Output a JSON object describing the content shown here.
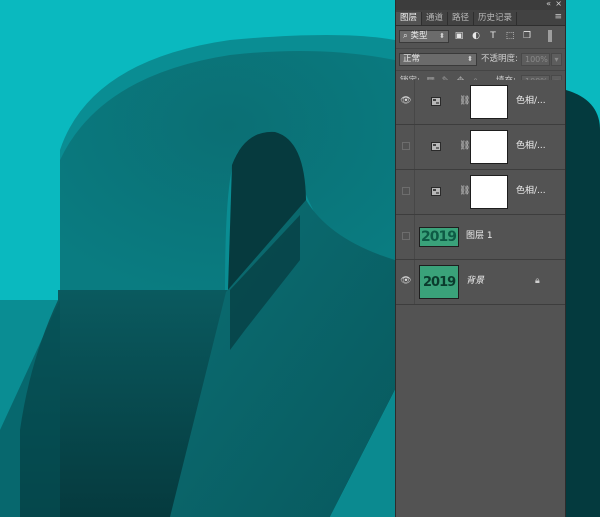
{
  "panel": {
    "collapse_icon": "double-chevron-left-icon",
    "close_icon": "close-icon",
    "tabs": [
      {
        "label": "图层",
        "active": true
      },
      {
        "label": "通道",
        "active": false
      },
      {
        "label": "路径",
        "active": false
      },
      {
        "label": "历史记录",
        "active": false
      }
    ],
    "menu_icon": "panel-menu-icon"
  },
  "filter": {
    "kind_label": "类型",
    "icons": [
      "pixel-filter-icon",
      "adjustment-filter-icon",
      "type-filter-icon",
      "shape-filter-icon",
      "smart-object-filter-icon"
    ]
  },
  "blend": {
    "mode": "正常",
    "opacity_label": "不透明度:",
    "opacity_value": "100%"
  },
  "lock": {
    "label": "锁定:",
    "fill_label": "填充:",
    "fill_value": "100%"
  },
  "layers": [
    {
      "name": "色相/...",
      "type": "adjustment",
      "visible": true
    },
    {
      "name": "色相/...",
      "type": "adjustment",
      "visible": false
    },
    {
      "name": "色相/...",
      "type": "adjustment",
      "visible": false
    },
    {
      "name": "图层 1",
      "type": "image",
      "visible": false,
      "thumb_text": "2019"
    },
    {
      "name": "背景",
      "type": "background",
      "visible": true,
      "locked": true,
      "thumb_text": "2019"
    }
  ],
  "colors": {
    "canvas_bg": "#0ab9bf",
    "panel_bg": "#535353",
    "thumb_green": "#3aa27a"
  }
}
